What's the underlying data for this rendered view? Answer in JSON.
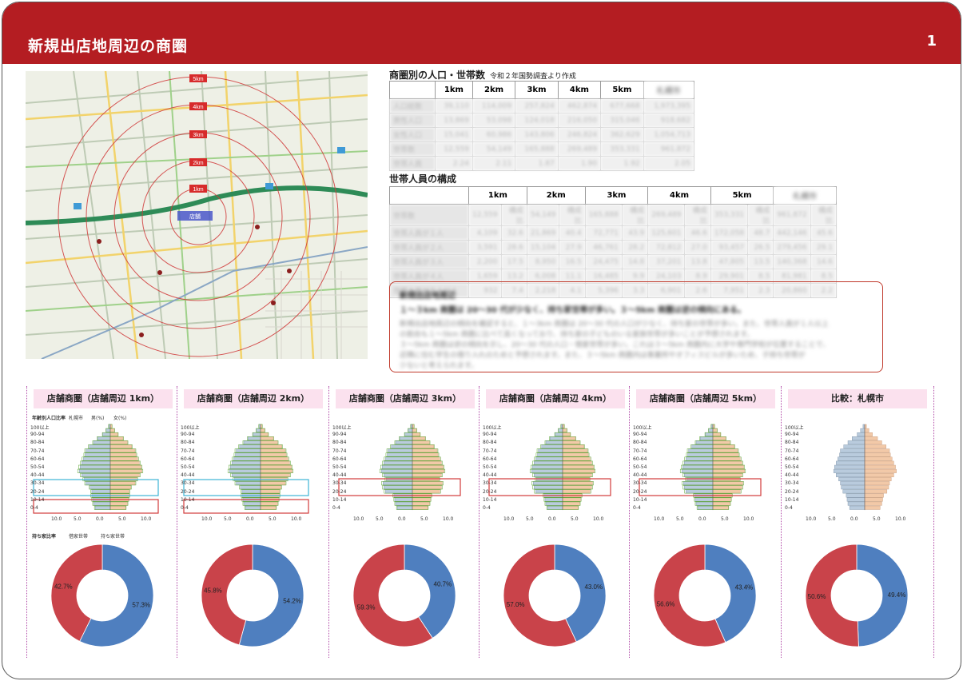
{
  "header": {
    "title": "新規出店地周辺の商圏",
    "page": "1"
  },
  "map": {
    "rings": [
      "5km",
      "4km",
      "3km",
      "2km",
      "1km"
    ],
    "store_label": "店舗"
  },
  "pop_table": {
    "title": "商圏別の人口・世帯数",
    "note": "令和２年国勢調査より作成",
    "columns": [
      "1km",
      "2km",
      "3km",
      "4km",
      "5km",
      "札幌市"
    ],
    "rows": [
      {
        "label": "人口総数",
        "values": [
          "39,110",
          "114,009",
          "257,824",
          "462,874",
          "677,668",
          "1,973,395"
        ]
      },
      {
        "label": "男性人口",
        "values": [
          "13,869",
          "53,098",
          "124,018",
          "216,050",
          "315,046",
          "918,682"
        ]
      },
      {
        "label": "女性人口",
        "values": [
          "15,041",
          "60,986",
          "143,806",
          "246,824",
          "362,629",
          "1,054,713"
        ]
      },
      {
        "label": "世帯数",
        "values": [
          "12,559",
          "54,149",
          "165,888",
          "269,489",
          "353,331",
          "961,872"
        ]
      },
      {
        "label": "世帯人員",
        "values": [
          "2.24",
          "2.11",
          "1.87",
          "1.90",
          "1.92",
          "2.05"
        ]
      }
    ]
  },
  "household_table": {
    "title": "世帯人員の構成",
    "columns": [
      "1km",
      "2km",
      "3km",
      "4km",
      "5km",
      "札幌市"
    ],
    "subcolumns": [
      "世帯数",
      "構成比"
    ],
    "rows": [
      {
        "label": "世帯数",
        "values": [
          "12,559",
          "構成比",
          "54,149",
          "構成比",
          "165,888",
          "構成比",
          "269,489",
          "構成比",
          "353,331",
          "構成比",
          "961,872",
          "構成比"
        ]
      },
      {
        "label": "世帯人員が１人",
        "values": [
          "4,109",
          "32.6",
          "21,869",
          "40.4",
          "72,771",
          "43.9",
          "125,601",
          "46.6",
          "172,058",
          "48.7",
          "442,146",
          "45.6"
        ]
      },
      {
        "label": "世帯人員が２人",
        "values": [
          "3,591",
          "28.6",
          "15,104",
          "27.9",
          "46,761",
          "28.2",
          "72,812",
          "27.0",
          "93,457",
          "26.5",
          "279,456",
          "29.1"
        ]
      },
      {
        "label": "世帯人員が３人",
        "values": [
          "2,200",
          "17.5",
          "8,950",
          "16.5",
          "24,475",
          "14.8",
          "37,201",
          "13.8",
          "47,805",
          "13.5",
          "140,368",
          "14.6"
        ]
      },
      {
        "label": "世帯人員が４人",
        "values": [
          "1,659",
          "13.2",
          "6,008",
          "11.1",
          "16,485",
          "9.9",
          "24,103",
          "8.9",
          "29,901",
          "8.5",
          "81,981",
          "8.5"
        ]
      },
      {
        "label": "世帯人員が５人以上",
        "values": [
          "932",
          "7.4",
          "2,218",
          "4.1",
          "5,396",
          "3.3",
          "6,901",
          "2.6",
          "7,951",
          "2.3",
          "20,860",
          "2.2"
        ]
      }
    ]
  },
  "notes_box": {
    "title": "新規出店地周辺",
    "headline": "１〜３km 商圏は 20〜30 代が少なく、持ち家世帯が多い。３〜5km 商圏は逆の傾向にある。",
    "body": [
      "新規出店地周辺の傾向を確認すると、１〜3km 商圏は 20〜30 代の人口が少なく、持ち家の世帯が多い。また、世帯人員が１人以上",
      "の割合も１〜5km 商圏に比べて高くなっており、持ち家の子どものいる家族世帯が多いことが予想されます。",
      "３〜5km 商圏は逆の傾向を示し、20〜30 代の人口・借家世帯が多い。これは３〜5km 商圏内に大学や専門学校が位置することで、",
      "近隣に住む学生の借り入れのためと予想されます。また、３〜5km 商圏内は事業所やオフィスビルが多いため、子持ち世帯が",
      "少ないと考えられます。"
    ]
  },
  "pyramid_common": {
    "age_labels": [
      "0-4",
      "10-14",
      "20-24",
      "30-34",
      "40-44",
      "50-54",
      "60-64",
      "70-74",
      "80-84",
      "90-94",
      "100以上"
    ],
    "x_ticks": [
      "10.0",
      "5.0",
      "0.0",
      "5.0",
      "10.0"
    ],
    "pyramid_caption": "年齢別人口比率",
    "pyramid_legend": [
      "札幌市",
      "男(%)",
      "女(%)"
    ],
    "donut_caption": "持ち家比率",
    "donut_legend": [
      "借家世帯",
      "持ち家世帯"
    ]
  },
  "panels": [
    {
      "title": "店舗商圏（店舗周辺 1km）",
      "donut": {
        "rent": 42.7,
        "own": 57.3,
        "rent_label": "42.7%",
        "own_label": "57.3%"
      }
    },
    {
      "title": "店舗商圏（店舗周辺 2km）",
      "donut": {
        "rent": 45.8,
        "own": 54.2,
        "rent_label": "45.8%",
        "own_label": "54.2%"
      }
    },
    {
      "title": "店舗商圏（店舗周辺 3km）",
      "donut": {
        "rent": 59.3,
        "own": 40.7,
        "rent_label": "59.3%",
        "own_label": "40.7%"
      }
    },
    {
      "title": "店舗商圏（店舗周辺 4km）",
      "donut": {
        "rent": 57.0,
        "own": 43.0,
        "rent_label": "57.0%",
        "own_label": "43.0%"
      }
    },
    {
      "title": "店舗商圏（店舗周辺 5km）",
      "donut": {
        "rent": 56.6,
        "own": 43.4,
        "rent_label": "56.6%",
        "own_label": "43.4%"
      }
    },
    {
      "title": "比較：札幌市",
      "donut": {
        "rent": 50.6,
        "own": 49.4,
        "rent_label": "50.6%",
        "own_label": "49.4%"
      }
    }
  ],
  "colors": {
    "header": "#b41d22",
    "rent": "#c9434a",
    "own": "#4f7fbf",
    "male": "#b9cbdd",
    "female": "#f2c9a8",
    "ref": "#5aa532"
  },
  "chart_data": [
    {
      "type": "pie",
      "title": "店舗商圏（店舗周辺 1km）",
      "categories": [
        "借家世帯",
        "持ち家世帯"
      ],
      "values": [
        42.7,
        57.3
      ]
    },
    {
      "type": "pie",
      "title": "店舗商圏（店舗周辺 2km）",
      "categories": [
        "借家世帯",
        "持ち家世帯"
      ],
      "values": [
        45.8,
        54.2
      ]
    },
    {
      "type": "pie",
      "title": "店舗商圏（店舗周辺 3km）",
      "categories": [
        "借家世帯",
        "持ち家世帯"
      ],
      "values": [
        59.3,
        40.7
      ]
    },
    {
      "type": "pie",
      "title": "店舗商圏（店舗周辺 4km）",
      "categories": [
        "借家世帯",
        "持ち家世帯"
      ],
      "values": [
        57.0,
        43.0
      ]
    },
    {
      "type": "pie",
      "title": "店舗商圏（店舗周辺 5km）",
      "categories": [
        "借家世帯",
        "持ち家世帯"
      ],
      "values": [
        56.6,
        43.4
      ]
    },
    {
      "type": "pie",
      "title": "比較：札幌市",
      "categories": [
        "借家世帯",
        "持ち家世帯"
      ],
      "values": [
        50.6,
        49.4
      ]
    }
  ]
}
